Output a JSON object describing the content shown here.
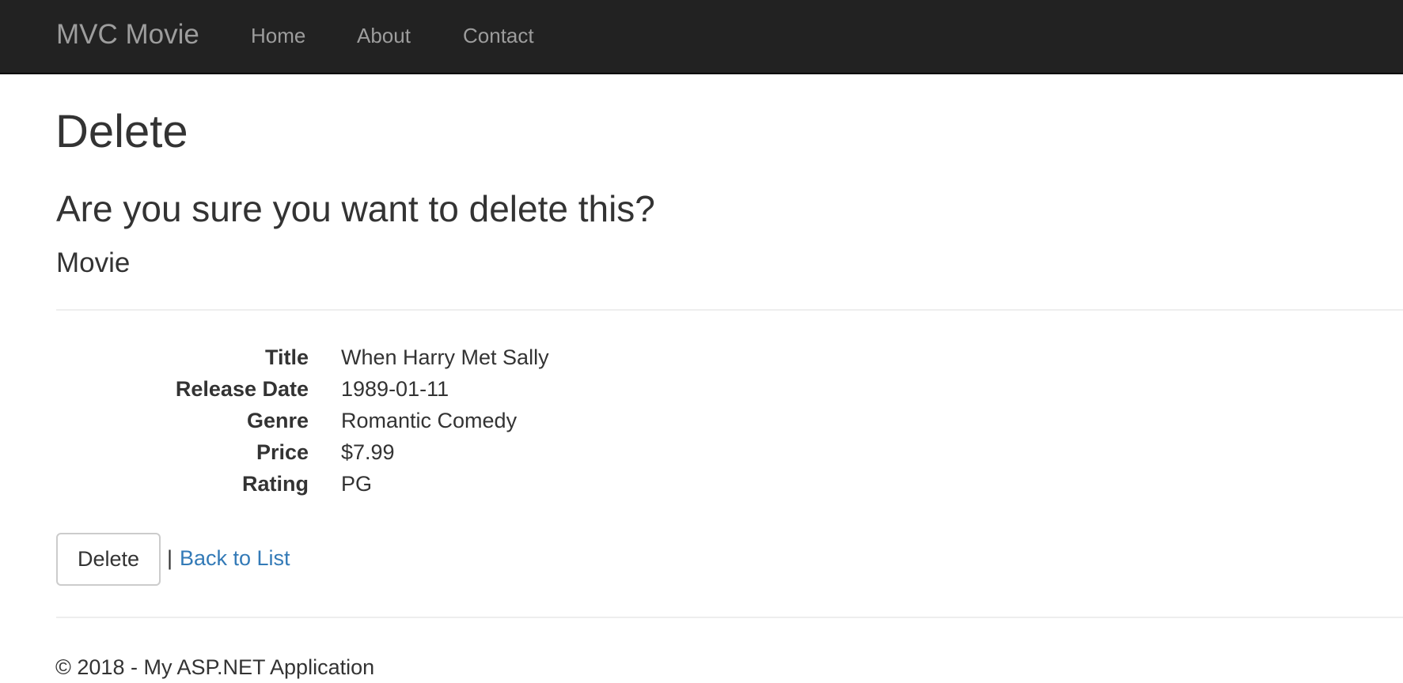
{
  "navbar": {
    "brand": "MVC Movie",
    "links": [
      {
        "label": "Home"
      },
      {
        "label": "About"
      },
      {
        "label": "Contact"
      }
    ]
  },
  "page": {
    "title": "Delete",
    "confirm_heading": "Are you sure you want to delete this?",
    "model_heading": "Movie"
  },
  "details": [
    {
      "label": "Title",
      "value": "When Harry Met Sally"
    },
    {
      "label": "Release Date",
      "value": "1989-01-11"
    },
    {
      "label": "Genre",
      "value": "Romantic Comedy"
    },
    {
      "label": "Price",
      "value": "$7.99"
    },
    {
      "label": "Rating",
      "value": "PG"
    }
  ],
  "actions": {
    "delete_label": "Delete",
    "separator": "|",
    "back_label": "Back to List"
  },
  "footer": {
    "text": "© 2018 - My ASP.NET Application"
  },
  "colors": {
    "navbar_bg": "#222222",
    "nav_text": "#9d9d9d",
    "link": "#337ab7",
    "text": "#333333"
  }
}
